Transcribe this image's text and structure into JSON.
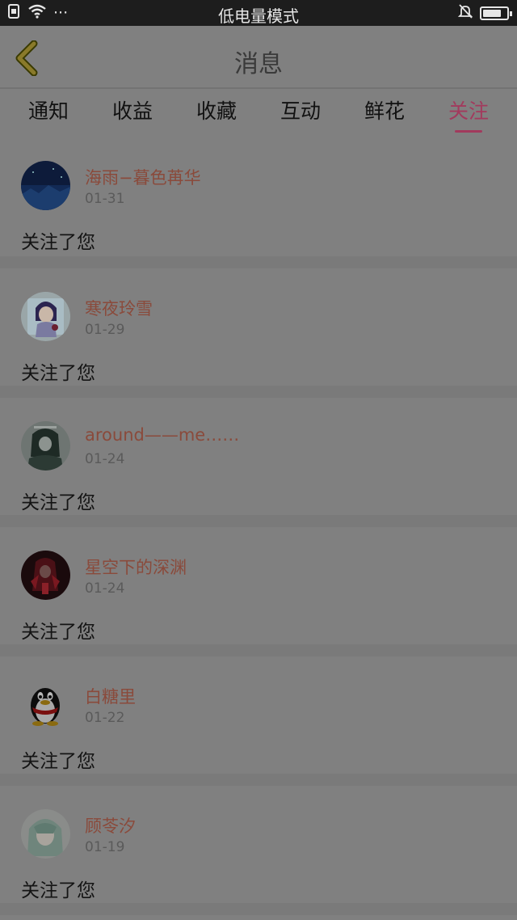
{
  "status_bar": {
    "title": "低电量模式",
    "dots": "···",
    "battery_level": 0.8
  },
  "header": {
    "title": "消息"
  },
  "tabs": [
    {
      "label": "通知",
      "active": false
    },
    {
      "label": "收益",
      "active": false
    },
    {
      "label": "收藏",
      "active": false
    },
    {
      "label": "互动",
      "active": false
    },
    {
      "label": "鲜花",
      "active": false
    },
    {
      "label": "关注",
      "active": true
    }
  ],
  "items": [
    {
      "name": "海雨−暮色苒华",
      "date": "01-31",
      "message": "关注了您",
      "avatar": "night-sky-avatar"
    },
    {
      "name": "寒夜玲雪",
      "date": "01-29",
      "message": "关注了您",
      "avatar": "anime-girl-avatar"
    },
    {
      "name": "around——me……",
      "date": "01-24",
      "message": "关注了您",
      "avatar": "dark-anime-avatar"
    },
    {
      "name": "星空下的深渊",
      "date": "01-24",
      "message": "关注了您",
      "avatar": "red-dark-avatar"
    },
    {
      "name": "白糖里",
      "date": "01-22",
      "message": "关注了您",
      "avatar": "penguin-avatar"
    },
    {
      "name": "顾苓汐",
      "date": "01-19",
      "message": "关注了您",
      "avatar": "green-hair-avatar"
    }
  ],
  "colors": {
    "accent": "#a23a5d",
    "name_text": "#8a4a3b",
    "overlay_bg": "#808080"
  }
}
